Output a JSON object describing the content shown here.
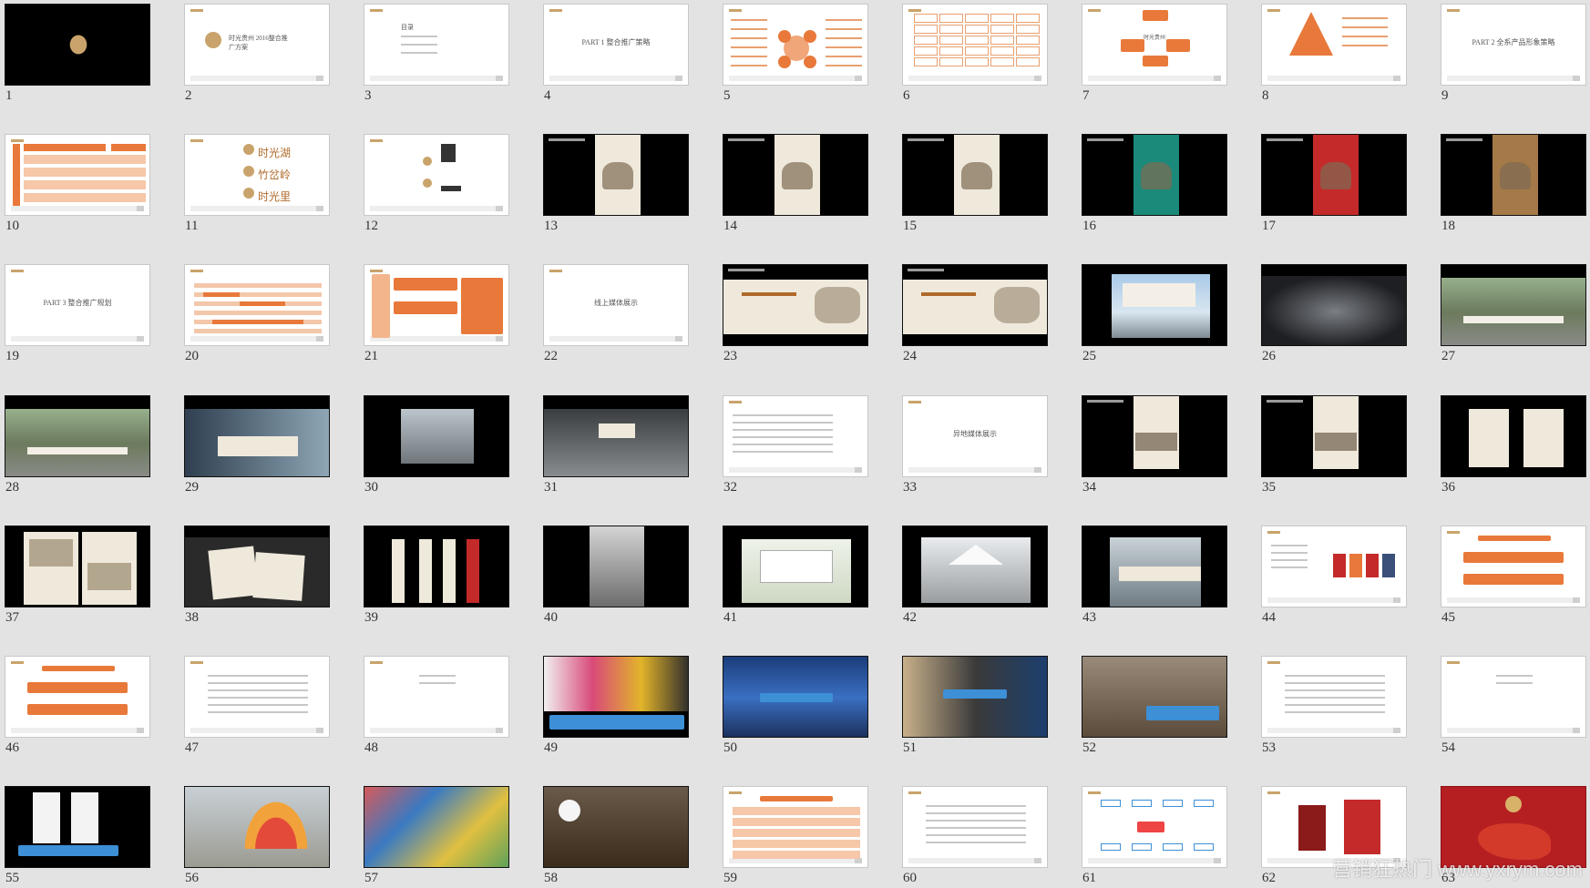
{
  "app": {
    "view": "slide-sorter"
  },
  "colors": {
    "background": "#e3e3e3",
    "accent": "#e8793a",
    "text": "#333333"
  },
  "slides": [
    {
      "num": "1",
      "bg": "black",
      "kind": "logo",
      "text": ""
    },
    {
      "num": "2",
      "bg": "white",
      "kind": "title-logo",
      "text": "时光贵州 2016整合推广方案"
    },
    {
      "num": "3",
      "bg": "white",
      "kind": "toc",
      "text": "目录"
    },
    {
      "num": "4",
      "bg": "white",
      "kind": "section",
      "text": "PART 1 整合推广策略"
    },
    {
      "num": "5",
      "bg": "white",
      "kind": "circles",
      "text": ""
    },
    {
      "num": "6",
      "bg": "white",
      "kind": "table",
      "text": ""
    },
    {
      "num": "7",
      "bg": "white",
      "kind": "org",
      "text": "时光贵州"
    },
    {
      "num": "8",
      "bg": "white",
      "kind": "pyramid",
      "text": ""
    },
    {
      "num": "9",
      "bg": "white",
      "kind": "section",
      "text": "PART 2 全系产品形象策略"
    },
    {
      "num": "10",
      "bg": "white",
      "kind": "orange-table",
      "text": ""
    },
    {
      "num": "11",
      "bg": "white",
      "kind": "names",
      "text": "时光湖 竹岔岭 时光里"
    },
    {
      "num": "12",
      "bg": "white",
      "kind": "names2",
      "text": ""
    },
    {
      "num": "13",
      "bg": "black",
      "kind": "poster",
      "text": ""
    },
    {
      "num": "14",
      "bg": "black",
      "kind": "poster",
      "text": ""
    },
    {
      "num": "15",
      "bg": "black",
      "kind": "poster",
      "text": ""
    },
    {
      "num": "16",
      "bg": "black",
      "kind": "poster-green",
      "text": ""
    },
    {
      "num": "17",
      "bg": "black",
      "kind": "poster-red",
      "text": ""
    },
    {
      "num": "18",
      "bg": "black",
      "kind": "poster-brown",
      "text": ""
    },
    {
      "num": "19",
      "bg": "white",
      "kind": "section",
      "text": "PART 3 整合推广规划"
    },
    {
      "num": "20",
      "bg": "white",
      "kind": "gantt",
      "text": ""
    },
    {
      "num": "21",
      "bg": "white",
      "kind": "orange-plan",
      "text": ""
    },
    {
      "num": "22",
      "bg": "white",
      "kind": "section",
      "text": "线上媒体展示"
    },
    {
      "num": "23",
      "bg": "black",
      "kind": "banner",
      "text": ""
    },
    {
      "num": "24",
      "bg": "black",
      "kind": "banner",
      "text": ""
    },
    {
      "num": "25",
      "bg": "black",
      "kind": "billboard",
      "text": ""
    },
    {
      "num": "26",
      "bg": "black",
      "kind": "photo-dark",
      "text": ""
    },
    {
      "num": "27",
      "bg": "black",
      "kind": "photo-street",
      "text": ""
    },
    {
      "num": "28",
      "bg": "black",
      "kind": "photo-street",
      "text": ""
    },
    {
      "num": "29",
      "bg": "black",
      "kind": "photo-building",
      "text": ""
    },
    {
      "num": "30",
      "bg": "black",
      "kind": "photo-gate",
      "text": ""
    },
    {
      "num": "31",
      "bg": "black",
      "kind": "photo-hall",
      "text": ""
    },
    {
      "num": "32",
      "bg": "white",
      "kind": "text",
      "text": ""
    },
    {
      "num": "33",
      "bg": "white",
      "kind": "section",
      "text": "异地媒体展示"
    },
    {
      "num": "34",
      "bg": "black",
      "kind": "poster-vertical",
      "text": ""
    },
    {
      "num": "35",
      "bg": "black",
      "kind": "poster-vertical",
      "text": ""
    },
    {
      "num": "36",
      "bg": "black",
      "kind": "posters-pair",
      "text": ""
    },
    {
      "num": "37",
      "bg": "black",
      "kind": "brochure",
      "text": ""
    },
    {
      "num": "38",
      "bg": "black",
      "kind": "magazine",
      "text": ""
    },
    {
      "num": "39",
      "bg": "black",
      "kind": "flags",
      "text": ""
    },
    {
      "num": "40",
      "bg": "black",
      "kind": "photo-fog",
      "text": ""
    },
    {
      "num": "41",
      "bg": "black",
      "kind": "truck",
      "text": ""
    },
    {
      "num": "42",
      "bg": "black",
      "kind": "tent",
      "text": ""
    },
    {
      "num": "43",
      "bg": "black",
      "kind": "fence",
      "text": ""
    },
    {
      "num": "44",
      "bg": "white",
      "kind": "products",
      "text": ""
    },
    {
      "num": "45",
      "bg": "white",
      "kind": "orange-plan2",
      "text": ""
    },
    {
      "num": "46",
      "bg": "white",
      "kind": "orange-plan2",
      "text": ""
    },
    {
      "num": "47",
      "bg": "white",
      "kind": "text-center",
      "text": ""
    },
    {
      "num": "48",
      "bg": "white",
      "kind": "text-small",
      "text": ""
    },
    {
      "num": "49",
      "bg": "black",
      "kind": "collage",
      "text": ""
    },
    {
      "num": "50",
      "bg": "black",
      "kind": "event-blue",
      "text": ""
    },
    {
      "num": "51",
      "bg": "black",
      "kind": "event",
      "text": ""
    },
    {
      "num": "52",
      "bg": "black",
      "kind": "event-crowd",
      "text": ""
    },
    {
      "num": "53",
      "bg": "white",
      "kind": "text-center",
      "text": ""
    },
    {
      "num": "54",
      "bg": "white",
      "kind": "text-small",
      "text": ""
    },
    {
      "num": "55",
      "bg": "black",
      "kind": "phones",
      "text": ""
    },
    {
      "num": "56",
      "bg": "black",
      "kind": "inflatable",
      "text": ""
    },
    {
      "num": "57",
      "bg": "black",
      "kind": "crowd-color",
      "text": ""
    },
    {
      "num": "58",
      "bg": "black",
      "kind": "mascot",
      "text": ""
    },
    {
      "num": "59",
      "bg": "white",
      "kind": "orange-table2",
      "text": ""
    },
    {
      "num": "60",
      "bg": "white",
      "kind": "text-center",
      "text": ""
    },
    {
      "num": "61",
      "bg": "white",
      "kind": "mindmap",
      "text": ""
    },
    {
      "num": "62",
      "bg": "white",
      "kind": "red-items",
      "text": ""
    },
    {
      "num": "63",
      "bg": "red",
      "kind": "red-cover",
      "text": ""
    }
  ],
  "watermark": "营销狂热门 www.yxrym.com"
}
